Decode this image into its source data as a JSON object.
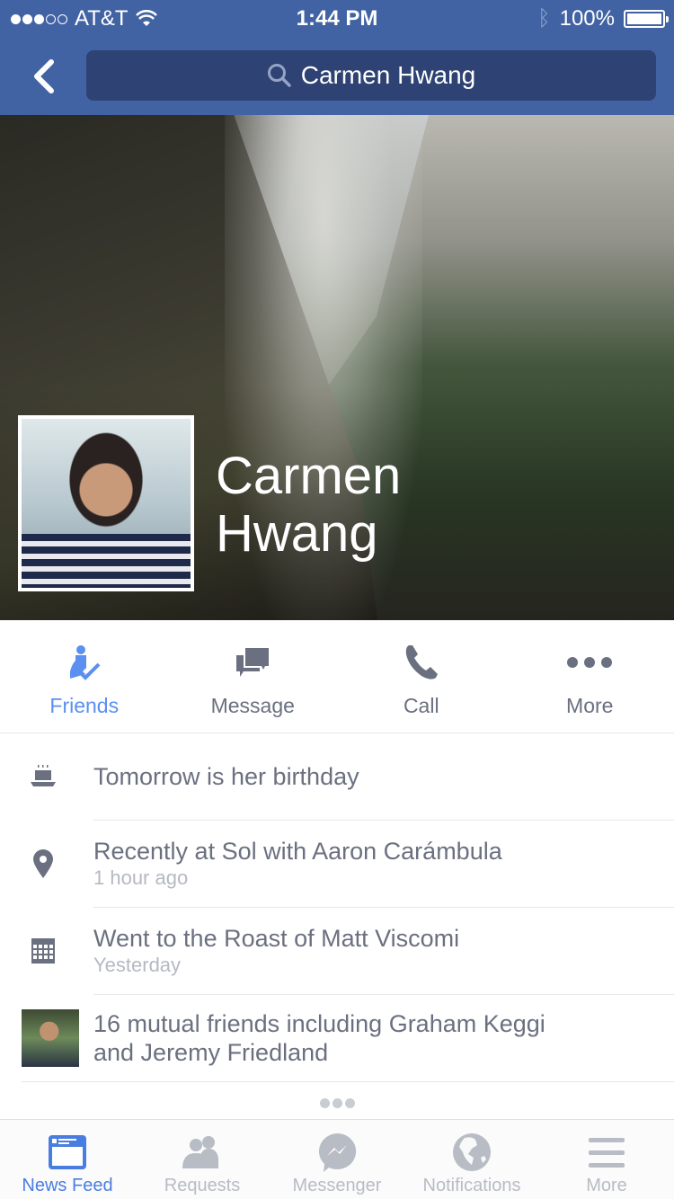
{
  "status_bar": {
    "signal_filled": 3,
    "signal_total": 5,
    "carrier": "AT&T",
    "time": "1:44 PM",
    "battery": "100%",
    "battery_level": 1.0
  },
  "nav": {
    "back_icon": "chevron-left-icon",
    "search_query": "Carmen Hwang"
  },
  "profile": {
    "name_first": "Carmen",
    "name_last": "Hwang"
  },
  "actions": [
    {
      "label": "Friends",
      "icon": "friends-check-icon",
      "active": true
    },
    {
      "label": "Message",
      "icon": "message-icon",
      "active": false
    },
    {
      "label": "Call",
      "icon": "phone-icon",
      "active": false
    },
    {
      "label": "More",
      "icon": "more-dots-icon",
      "active": false
    }
  ],
  "info": [
    {
      "icon": "birthday-cake-icon",
      "text": "Tomorrow is her birthday",
      "sub": ""
    },
    {
      "icon": "location-pin-icon",
      "text": "Recently at Sol with Aaron Carámbula",
      "sub": "1 hour ago"
    },
    {
      "icon": "calendar-icon",
      "text": "Went to the Roast of Matt Viscomi",
      "sub": "Yesterday"
    },
    {
      "icon": "mutual-friend-photo",
      "text_line1": "16 mutual friends including Graham Keggi",
      "text_line2": "and Jeremy Friedland"
    }
  ],
  "tabs": [
    {
      "label": "News Feed",
      "icon": "news-feed-icon",
      "active": true
    },
    {
      "label": "Requests",
      "icon": "friend-requests-icon",
      "active": false
    },
    {
      "label": "Messenger",
      "icon": "messenger-icon",
      "active": false
    },
    {
      "label": "Notifications",
      "icon": "globe-icon",
      "active": false
    },
    {
      "label": "More",
      "icon": "hamburger-menu-icon",
      "active": false
    }
  ],
  "colors": {
    "brand_blue": "#4263a3",
    "search_bg": "#2e4373",
    "active_blue": "#5b8ff0",
    "text_gray": "#6b7080",
    "inactive_tab": "#b8bcc4"
  }
}
